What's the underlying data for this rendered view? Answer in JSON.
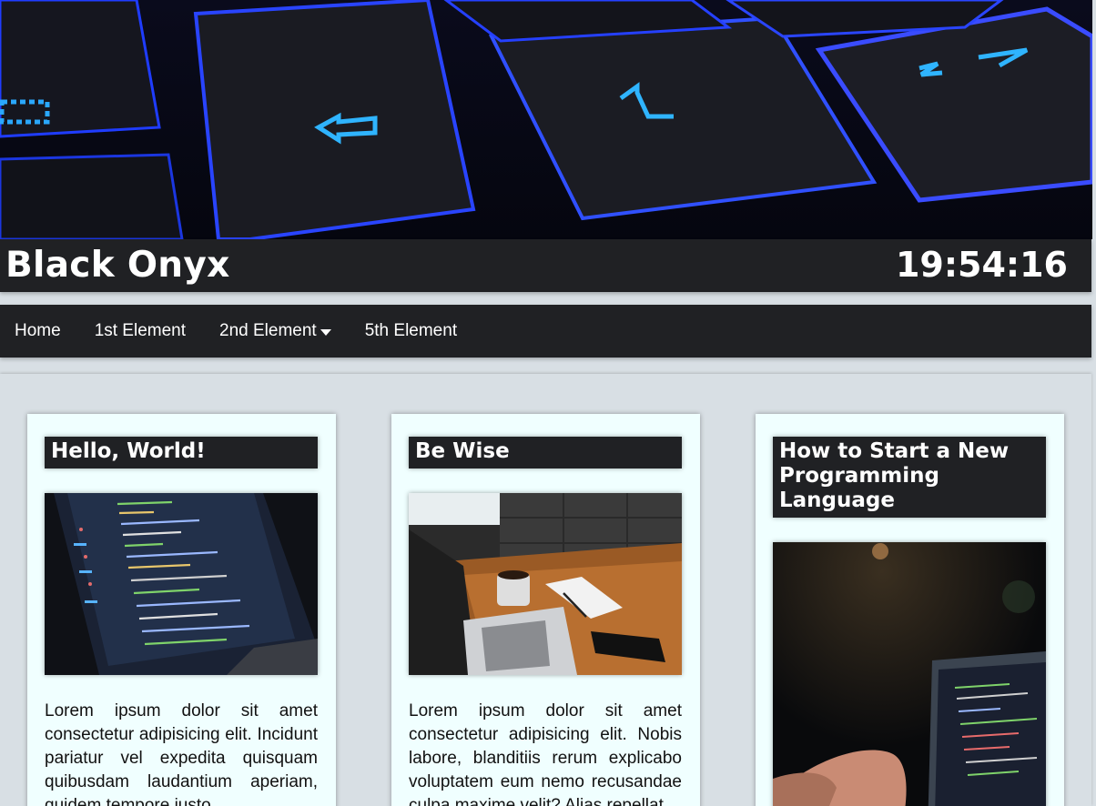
{
  "header": {
    "title": "Black Onyx",
    "clock": "19:54:16",
    "banner_image": "blue-backlit-keyboard"
  },
  "nav": {
    "items": [
      {
        "label": "Home"
      },
      {
        "label": "1st Element"
      },
      {
        "label": "2nd Element",
        "has_dropdown": true
      },
      {
        "label": "5th Element"
      }
    ]
  },
  "cards": [
    {
      "title": "Hello, World!",
      "image": "laptop-code-screen",
      "text": "Lorem ipsum dolor sit amet consectetur adipisicing elit. Incidunt pariatur vel expedita quisquam quibusdam laudantium aperiam, quidem tempore iusto"
    },
    {
      "title": "Be Wise",
      "image": "desk-laptop-coffee",
      "text": "Lorem ipsum dolor sit amet consectetur adipisicing elit. Nobis labore, blanditiis rerum explicabo voluptatem eum nemo recusandae culpa maxime velit? Alias repellat"
    },
    {
      "title": "How to Start a New Programming Language",
      "image": "laptop-dark-room",
      "text": ""
    }
  ],
  "colors": {
    "bar": "#202124",
    "page_bg": "#d8dfe4",
    "card_bg": "#f0ffff"
  }
}
